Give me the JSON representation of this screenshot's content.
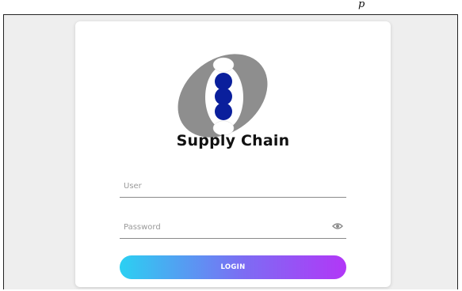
{
  "header": {
    "corner_mark": "p"
  },
  "brand": {
    "name": "Supply Chain",
    "logo_icon": "supply-chain-logo-icon"
  },
  "form": {
    "user_placeholder": "User",
    "password_placeholder": "Password",
    "password_toggle_icon": "eye-icon",
    "login_label": "LOGIN"
  },
  "colors": {
    "logo_gray": "#8e8e8e",
    "logo_blue": "#0a1f9c",
    "button_start": "#2bd0f2",
    "button_end": "#b237f7"
  }
}
